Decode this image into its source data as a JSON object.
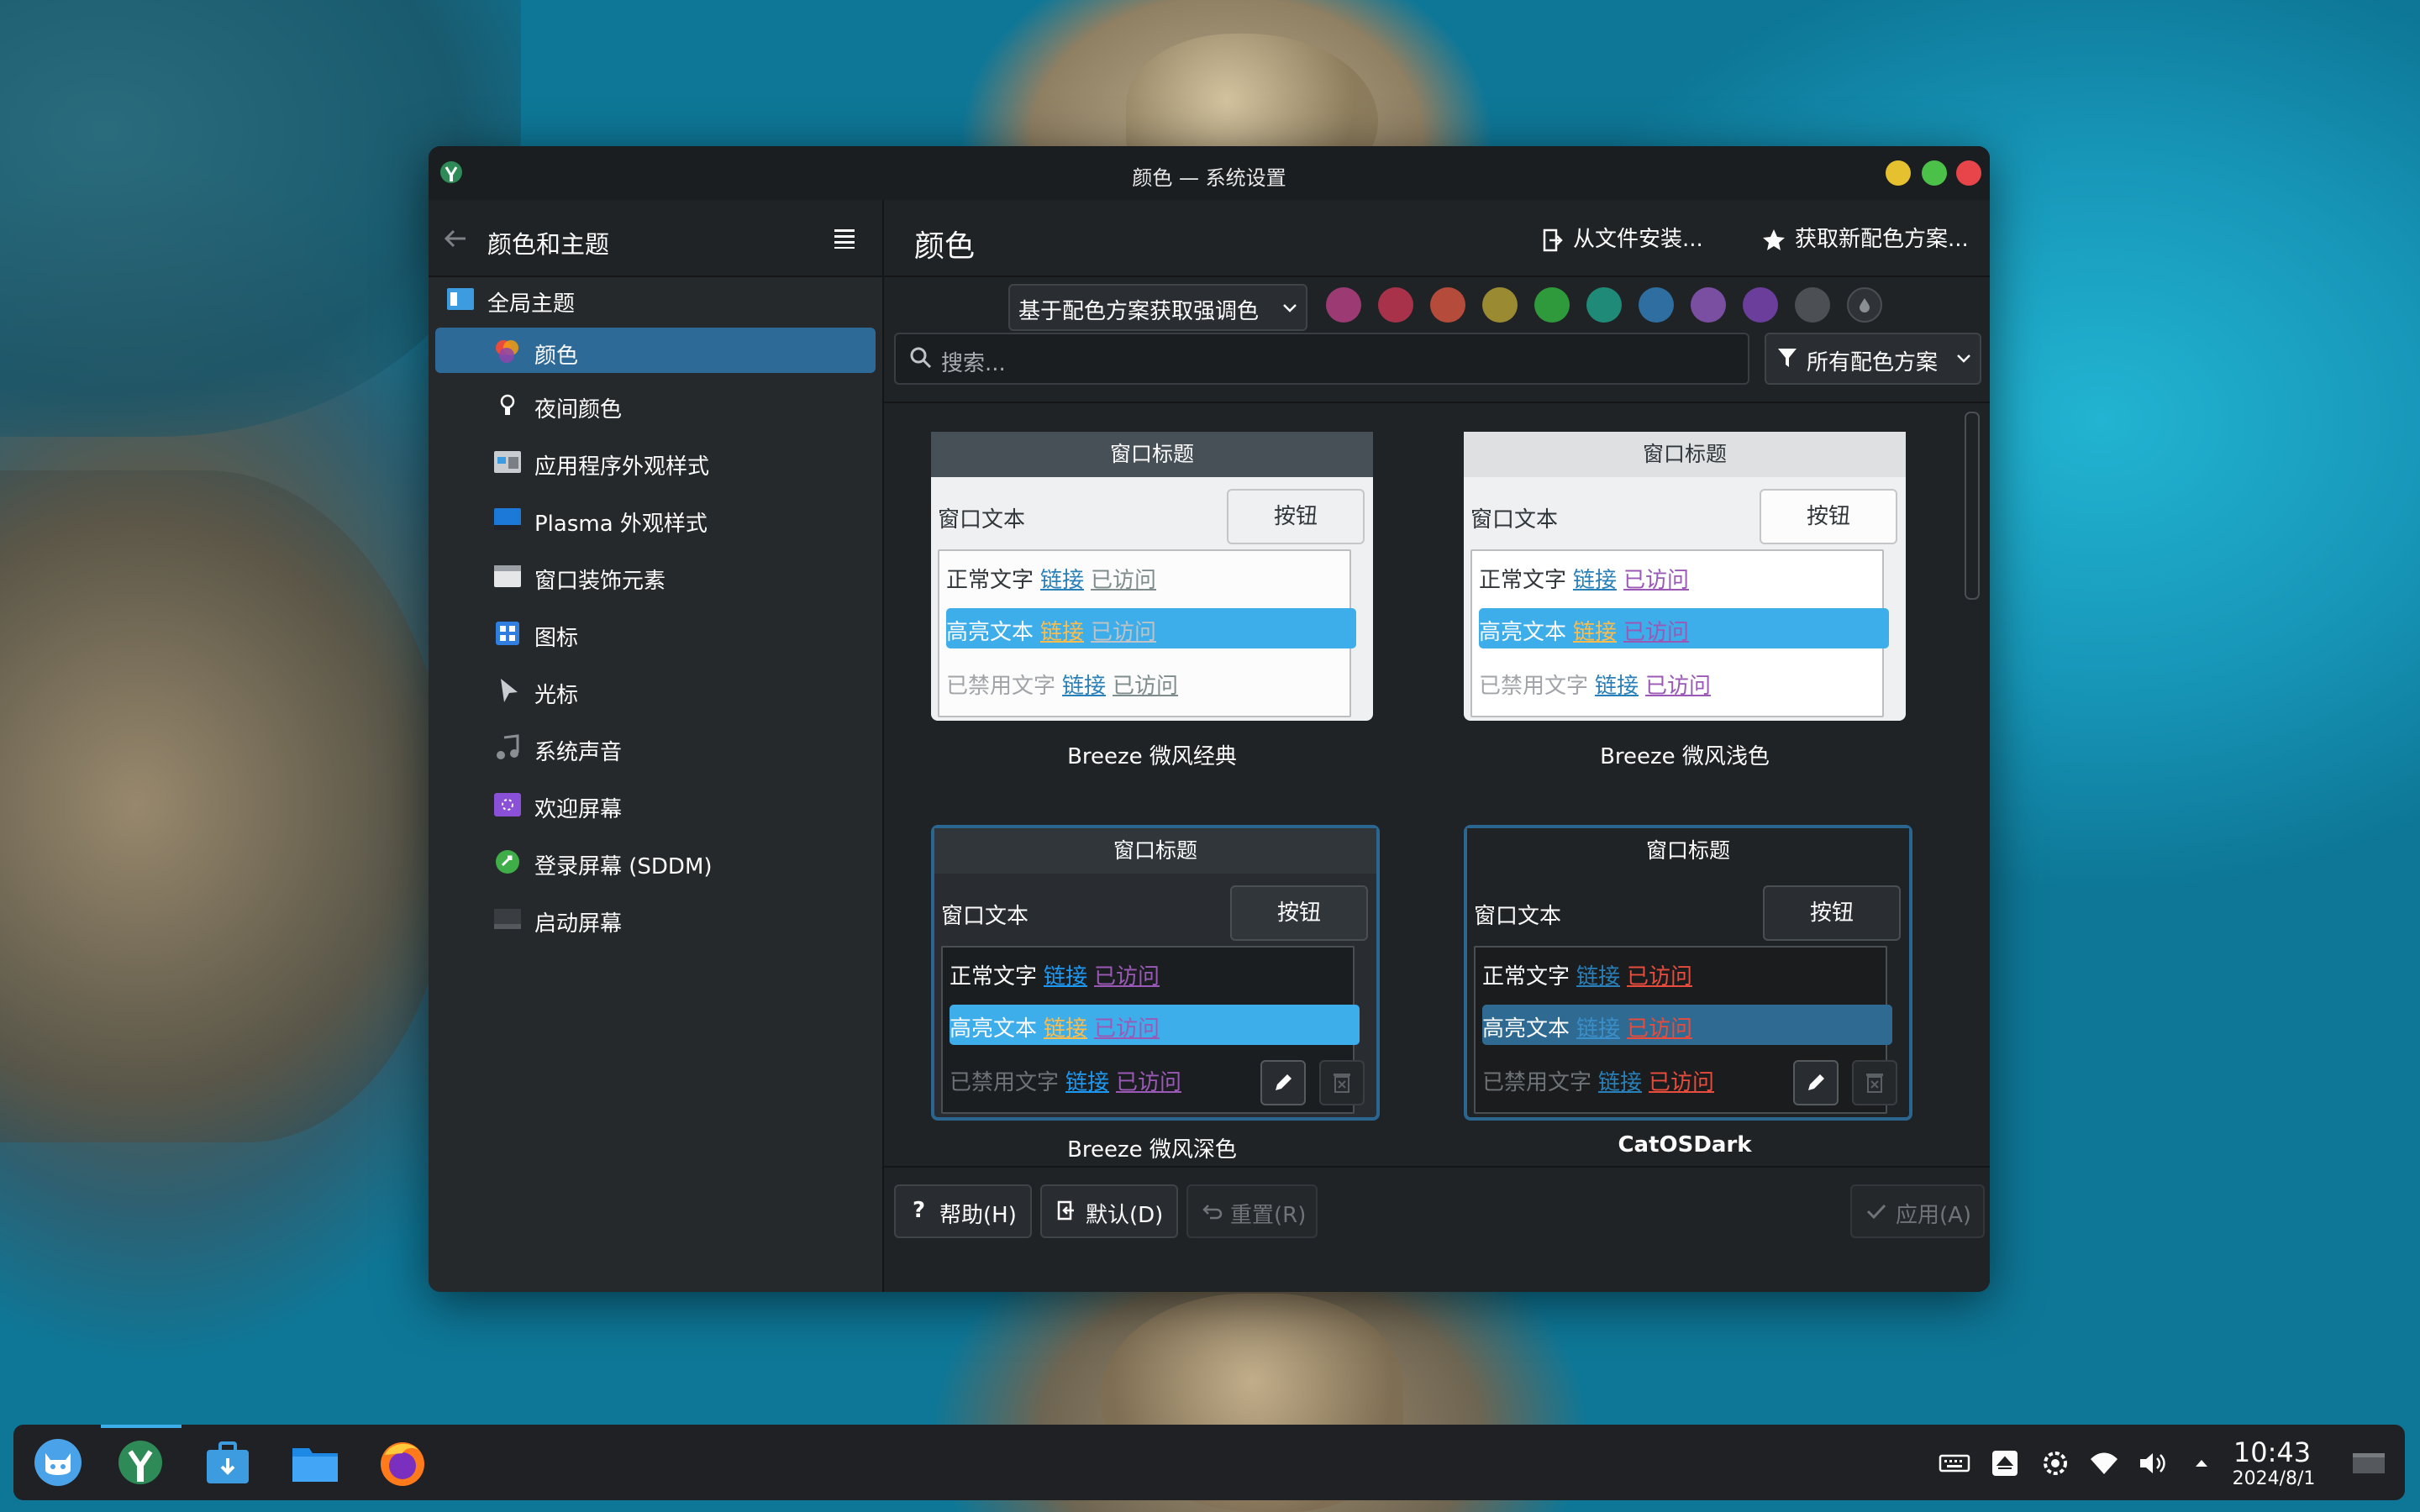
{
  "window": {
    "title": "颜色 — 系统设置"
  },
  "sidebar": {
    "title": "颜色和主题",
    "items": [
      {
        "label": "全局主题",
        "icon": "global-theme-icon"
      },
      {
        "label": "颜色",
        "icon": "colors-icon",
        "active": true
      },
      {
        "label": "夜间颜色",
        "icon": "night-color-icon"
      },
      {
        "label": "应用程序外观样式",
        "icon": "app-style-icon"
      },
      {
        "label": "Plasma 外观样式",
        "icon": "plasma-style-icon"
      },
      {
        "label": "窗口装饰元素",
        "icon": "window-decoration-icon"
      },
      {
        "label": "图标",
        "icon": "icons-icon"
      },
      {
        "label": "光标",
        "icon": "cursor-icon"
      },
      {
        "label": "系统声音",
        "icon": "system-sounds-icon"
      },
      {
        "label": "欢迎屏幕",
        "icon": "splash-screen-icon"
      },
      {
        "label": "登录屏幕 (SDDM)",
        "icon": "login-screen-icon"
      },
      {
        "label": "启动屏幕",
        "icon": "boot-splash-icon"
      }
    ]
  },
  "main": {
    "title": "颜色",
    "install_from_file": "从文件安装...",
    "get_new": "获取新配色方案...",
    "accent_combo": "基于配色方案获取强调色",
    "accent_colors": [
      "#9b3a73",
      "#a8324a",
      "#b54b3a",
      "#9a8a31",
      "#2e9a3b",
      "#1f8a78",
      "#2e6ea0",
      "#7a4ea0",
      "#6a3e9a",
      "#4c4f53"
    ],
    "search_placeholder": "搜索...",
    "filter": "所有配色方案"
  },
  "preview": {
    "window_title": "窗口标题",
    "window_text": "窗口文本",
    "button": "按钮",
    "normal_text": "正常文字",
    "link": "链接",
    "visited": "已访问",
    "highlight_text": "高亮文本",
    "disabled_text": "已禁用文字"
  },
  "schemes": [
    {
      "name": "Breeze 微风经典"
    },
    {
      "name": "Breeze 微风浅色"
    },
    {
      "name": "Breeze 微风深色"
    },
    {
      "name": "CatOSDark",
      "selected": true
    }
  ],
  "footer": {
    "help": "帮助(H)",
    "defaults": "默认(D)",
    "reset": "重置(R)",
    "apply": "应用(A)"
  },
  "taskbar": {
    "time": "10:43",
    "date": "2024/8/1"
  }
}
